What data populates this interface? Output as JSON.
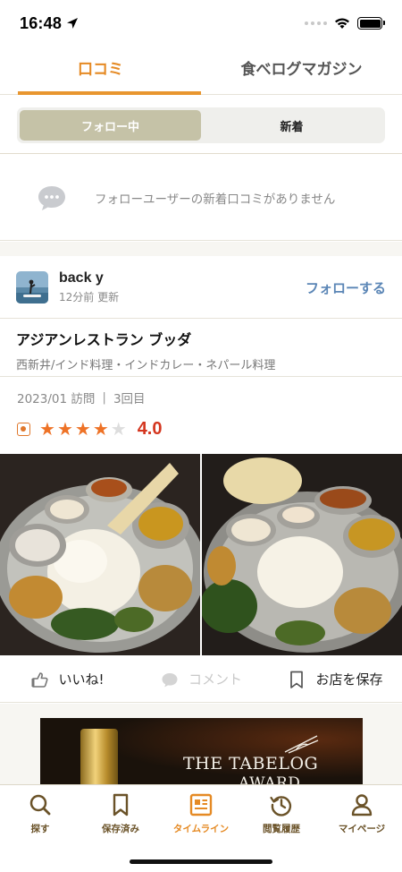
{
  "status": {
    "time": "16:48"
  },
  "tabs": [
    {
      "label": "口コミ",
      "active": true
    },
    {
      "label": "食べログマガジン",
      "active": false
    }
  ],
  "segment": [
    {
      "label": "フォロー中",
      "active": true
    },
    {
      "label": "新着",
      "active": false
    }
  ],
  "empty_message": "フォローユーザーの新着口コミがありません",
  "post": {
    "user_name": "back y",
    "posted": "12分前 更新",
    "follow_label": "フォローする",
    "restaurant_name": "アジアンレストラン ブッダ",
    "restaurant_genre": "西新井/インド料理・インドカレー・ネパール料理",
    "visit_date": "2023/01 訪問",
    "visit_count": "3回目",
    "rating": "4.0",
    "stars_filled": 4,
    "stars_total": 5
  },
  "actions": {
    "like": "いいね!",
    "comment": "コメント",
    "save": "お店を保存"
  },
  "ad": {
    "title": "THE TABELOG",
    "subtitle": "AWARD"
  },
  "nav": [
    {
      "label": "探す",
      "icon": "search-icon",
      "active": false
    },
    {
      "label": "保存済み",
      "icon": "bookmark-icon",
      "active": false
    },
    {
      "label": "タイムライン",
      "icon": "timeline-icon",
      "active": true
    },
    {
      "label": "閲覧履歴",
      "icon": "history-icon",
      "active": false
    },
    {
      "label": "マイページ",
      "icon": "person-icon",
      "active": false
    }
  ],
  "colors": {
    "accent": "#e58a24",
    "rating": "#d4361f",
    "link": "#5b86b6",
    "segment_active": "#c5c2a7"
  }
}
